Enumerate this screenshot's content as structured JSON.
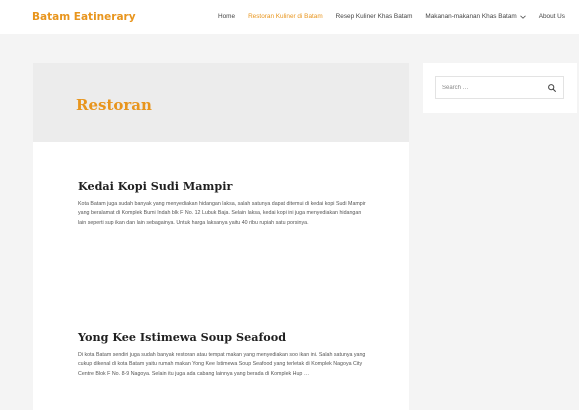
{
  "header": {
    "logo": "Batam Eatinerary",
    "nav": [
      {
        "label": "Home",
        "active": false
      },
      {
        "label": "Restoran Kuliner di Batam",
        "active": true
      },
      {
        "label": "Resep Kuliner Khas Batam",
        "active": false
      },
      {
        "label": "Makanan-makanan Khas Batam",
        "active": false,
        "has_dropdown": true
      },
      {
        "label": "About Us",
        "active": false
      }
    ]
  },
  "main": {
    "page_title": "Restoran",
    "posts": [
      {
        "title": "Kedai Kopi Sudi Mampir",
        "excerpt": "Kota Batam juga sudah banyak yang menyediakan hidangan laksa, salah satunya dapat ditemui di kedai kopi Sudi Mampir yang beralamat di Komplek Bumi Indah blk F No. 12 Lubuk Baja. Selain laksa, kedai kopi ini juga menyediakan hidangan lain seperti sup ikan dan lain sebagainya. Untuk harga laksanya yaitu 40 ribu rupiah satu porsinya."
      },
      {
        "title": "Yong Kee Istimewa Soup Seafood",
        "excerpt": "Di kota Batam sendiri juga sudah banyak restoran atau tempat makan yang menyediakan soo ikan ini. Salah satunya yang cukup dikenal di kota Batam yaitu rumah makan Yong Kee Istimewa Soup Seafood yang terletak di Komplek Nagoya City Centre Blok F No. 8-9 Nagoya. Selain itu juga ada cabang lainnya yang berada di Komplek Hup …"
      }
    ]
  },
  "sidebar": {
    "search_placeholder": "Search …"
  },
  "colors": {
    "accent": "#e8951d",
    "page_background": "#f4f4f4",
    "title_band": "#ececec"
  },
  "icons": {
    "search": "search-icon",
    "dropdown": "chevron-down-icon"
  }
}
